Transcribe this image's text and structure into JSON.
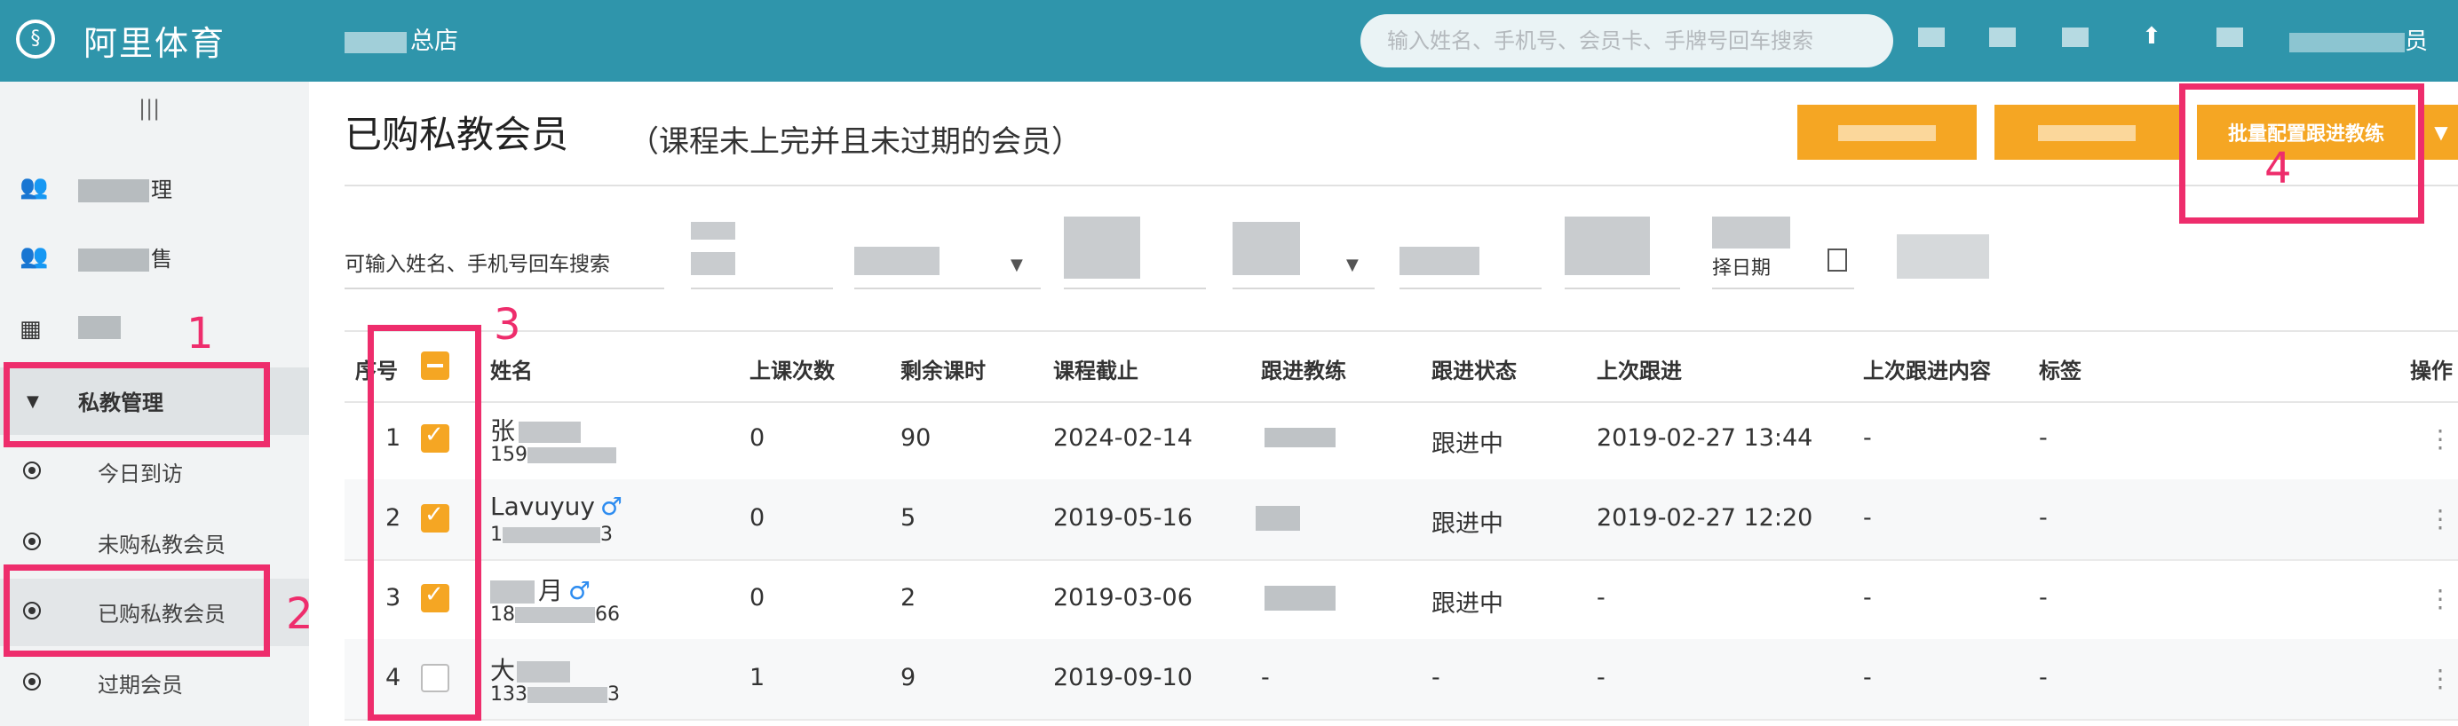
{
  "app": {
    "brand": "阿里体育",
    "store_suffix": "总店"
  },
  "search": {
    "placeholder": "输入姓名、手机号、会员卡、手牌号回车搜索"
  },
  "user": {
    "suffix": "员"
  },
  "sidebar": {
    "items": [
      {
        "label_suffix": "理",
        "icon": "users-icon"
      },
      {
        "label_suffix": "售",
        "icon": "users-icon"
      },
      {
        "label_suffix": "",
        "icon": "calendar-icon"
      }
    ],
    "parent": {
      "label": "私教管理"
    },
    "subitems": [
      {
        "label": "今日到访"
      },
      {
        "label": "未购私教会员"
      },
      {
        "label": "已购私教会员"
      },
      {
        "label": "过期会员"
      }
    ]
  },
  "page": {
    "title": "已购私教会员",
    "subtitle": "（课程未上完并且未过期的会员）",
    "buttons": {
      "primary": "批量配置跟进教练"
    }
  },
  "filters": {
    "hint": "可输入姓名、手机号回车搜索",
    "date_label": "择日期"
  },
  "table": {
    "columns": [
      "序号",
      "姓名",
      "上课次数",
      "剩余课时",
      "课程截止",
      "跟进教练",
      "跟进状态",
      "上次跟进",
      "上次跟进内容",
      "标签",
      "操作"
    ],
    "rows": [
      {
        "index": "1",
        "name": "张",
        "phone": "159",
        "male": false,
        "classes": "0",
        "remaining": "90",
        "deadline": "2024-02-14",
        "coach": "",
        "status": "跟进中",
        "last": "2019-02-27 13:44",
        "last_content": "-",
        "tags": "-",
        "checked": true
      },
      {
        "index": "2",
        "name": "Lavuyuy",
        "phone": "1",
        "phone_tail": "3",
        "male": true,
        "classes": "0",
        "remaining": "5",
        "deadline": "2019-05-16",
        "coach": "",
        "status": "跟进中",
        "last": "2019-02-27 12:20",
        "last_content": "-",
        "tags": "-",
        "checked": true
      },
      {
        "index": "3",
        "name": "月",
        "phone": "18",
        "phone_tail": "66",
        "male": true,
        "classes": "0",
        "remaining": "2",
        "deadline": "2019-03-06",
        "coach": "",
        "status": "跟进中",
        "last": "-",
        "last_content": "-",
        "tags": "-",
        "checked": true
      },
      {
        "index": "4",
        "name": "大",
        "phone": "133",
        "phone_tail": "3",
        "male": false,
        "classes": "1",
        "remaining": "9",
        "deadline": "2019-09-10",
        "coach": "-",
        "status": "-",
        "last": "-",
        "last_content": "-",
        "tags": "-",
        "checked": false
      }
    ]
  },
  "annotations": [
    "1",
    "2",
    "3",
    "4"
  ],
  "colors": {
    "topbar": "#2f95ab",
    "accent": "#f5a623",
    "annotation": "#ee2d6c",
    "male": "#2d8cf0"
  }
}
